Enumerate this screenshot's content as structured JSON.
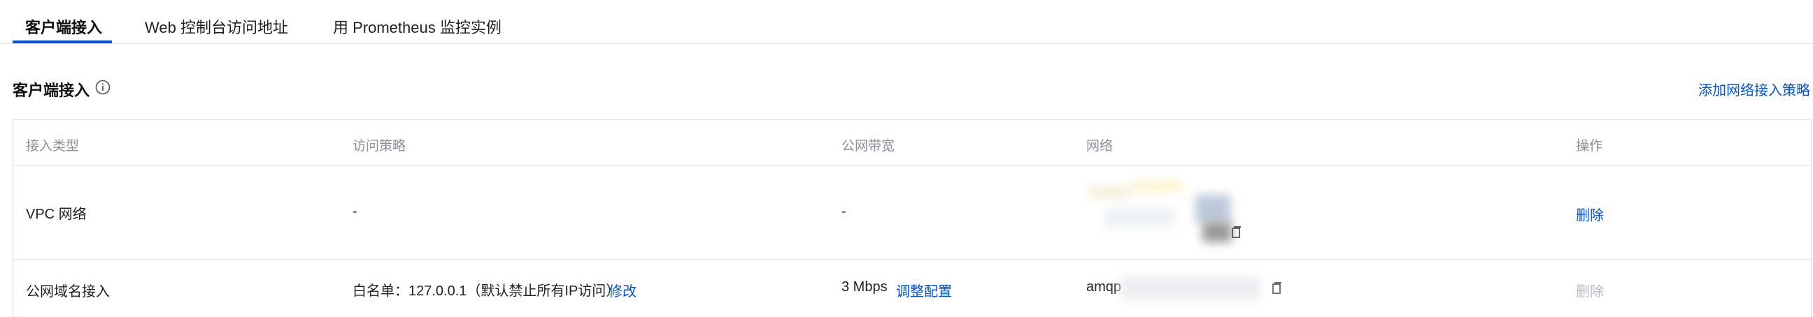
{
  "tabs": [
    {
      "label": "客户端接入"
    },
    {
      "label": "Web 控制台访问地址"
    },
    {
      "label": "用 Prometheus 监控实例"
    }
  ],
  "section": {
    "title": "客户端接入",
    "add_link": "添加网络接入策略"
  },
  "table": {
    "headers": [
      "接入类型",
      "访问策略",
      "公网带宽",
      "网络",
      "操作"
    ],
    "rows": [
      {
        "type": "VPC 网络",
        "policy": "-",
        "bandwidth": "-",
        "network": "",
        "action": "删除"
      },
      {
        "type": "公网域名接入",
        "policy": "白名单：127.0.0.1（默认禁止所有IP访问）",
        "policy_action": "修改",
        "bandwidth": "3 Mbps",
        "bandwidth_action": "调整配置",
        "network": "amqp",
        "action": "删除"
      }
    ]
  },
  "colors": {
    "accent": "#0052d9",
    "disabled": "#b8bcc4",
    "header_text": "#8a8f99",
    "border": "#dcdee3"
  },
  "icons": [
    "info-icon",
    "copy-icon"
  ]
}
